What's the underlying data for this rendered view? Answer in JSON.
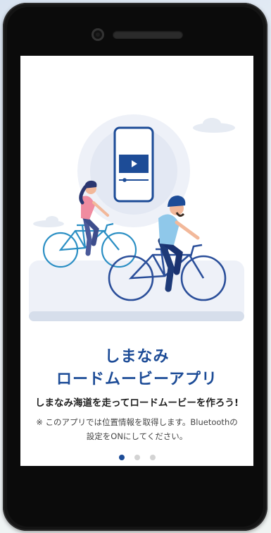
{
  "onboarding": {
    "title_line1": "しまなみ",
    "title_line2": "ロードムービーアプリ",
    "subtitle": "しまなみ海道を走ってロードムービーを作ろう!",
    "note_line1": "※ このアプリでは位置情報を取得します。Bluetoothの",
    "note_line2": "設定をONにしてください。",
    "pages_total": 3,
    "current_page": 1
  },
  "colors": {
    "brand_blue": "#1d4c97",
    "dot_inactive": "#d3d3d3",
    "device_body": "#141414"
  },
  "icons": {
    "video_play": "play-icon"
  }
}
